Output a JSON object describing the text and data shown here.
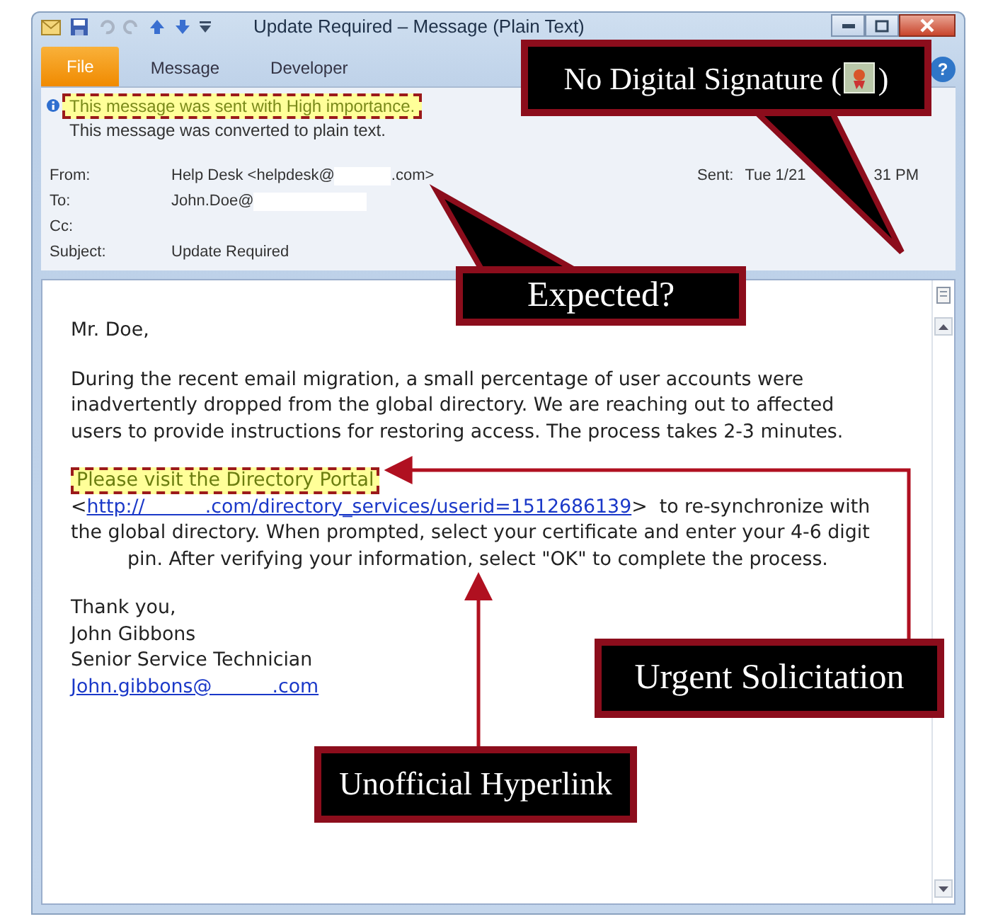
{
  "window": {
    "title": "Update Required – Message (Plain Text)"
  },
  "ribbon_tabs": [
    {
      "label": "File",
      "kind": "file"
    },
    {
      "label": "Message",
      "kind": "tab"
    },
    {
      "label": "Developer",
      "kind": "tab"
    }
  ],
  "help_glyph": "?",
  "info_lines": [
    {
      "text": "This message was sent with High importance.",
      "highlighted": true
    },
    {
      "text": "This message was converted to plain text.",
      "highlighted": false
    }
  ],
  "header_fields": [
    {
      "label": "From:",
      "parts": [
        {
          "kind": "text",
          "text": "Help Desk <helpdesk@"
        },
        {
          "kind": "redacted"
        },
        {
          "kind": "text",
          "text": ".com>"
        }
      ]
    },
    {
      "label": "To:",
      "parts": [
        {
          "kind": "text",
          "text": "John.Doe@"
        },
        {
          "kind": "redacted"
        }
      ]
    },
    {
      "label": "Cc:"
    },
    {
      "label": "Subject:",
      "parts": [
        {
          "kind": "text",
          "text": "Update Required"
        }
      ]
    }
  ],
  "sent": {
    "label": "Sent:",
    "parts": [
      {
        "kind": "text",
        "text": "Tue 1/21"
      },
      {
        "kind": "covered"
      },
      {
        "kind": "text",
        "text": "31 PM"
      }
    ]
  },
  "body": [
    {
      "kind": "text",
      "text": "Mr. Doe,"
    },
    {
      "kind": "gap"
    },
    {
      "kind": "text",
      "text": "During the recent email migration, a small percentage of user accounts were"
    },
    {
      "kind": "text",
      "text": "inadvertently dropped from the global directory. We are reaching out to affected"
    },
    {
      "kind": "text",
      "text": "users to provide instructions for restoring access. The process takes 2-3 minutes."
    },
    {
      "kind": "gap"
    },
    {
      "kind": "highlight",
      "text": "Please visit the Directory Portal"
    },
    {
      "kind": "link",
      "before": "<",
      "link": "http://          .com/directory_services/userid=1512686139",
      "after": ">  to re-synchronize with"
    },
    {
      "kind": "text",
      "text": "the global directory. When prompted, select your certificate and enter your 4-6 digit"
    },
    {
      "kind": "indented",
      "text": "pin. After verifying your information, select \"OK\" to complete the process."
    },
    {
      "kind": "gap"
    },
    {
      "kind": "text",
      "text": "Thank you,"
    },
    {
      "kind": "text",
      "text": "John Gibbons"
    },
    {
      "kind": "text",
      "text": "Senior Service Technician"
    },
    {
      "kind": "link",
      "link": "John.gibbons@          .com"
    }
  ],
  "callouts": [
    {
      "kind": "signature",
      "text": "No Digital Signature (",
      "after": ")"
    },
    {
      "kind": "plain",
      "text": "Expected?"
    },
    {
      "kind": "plain",
      "text": "Urgent Solicitation"
    },
    {
      "kind": "plain",
      "text": "Unofficial Hyperlink"
    }
  ]
}
